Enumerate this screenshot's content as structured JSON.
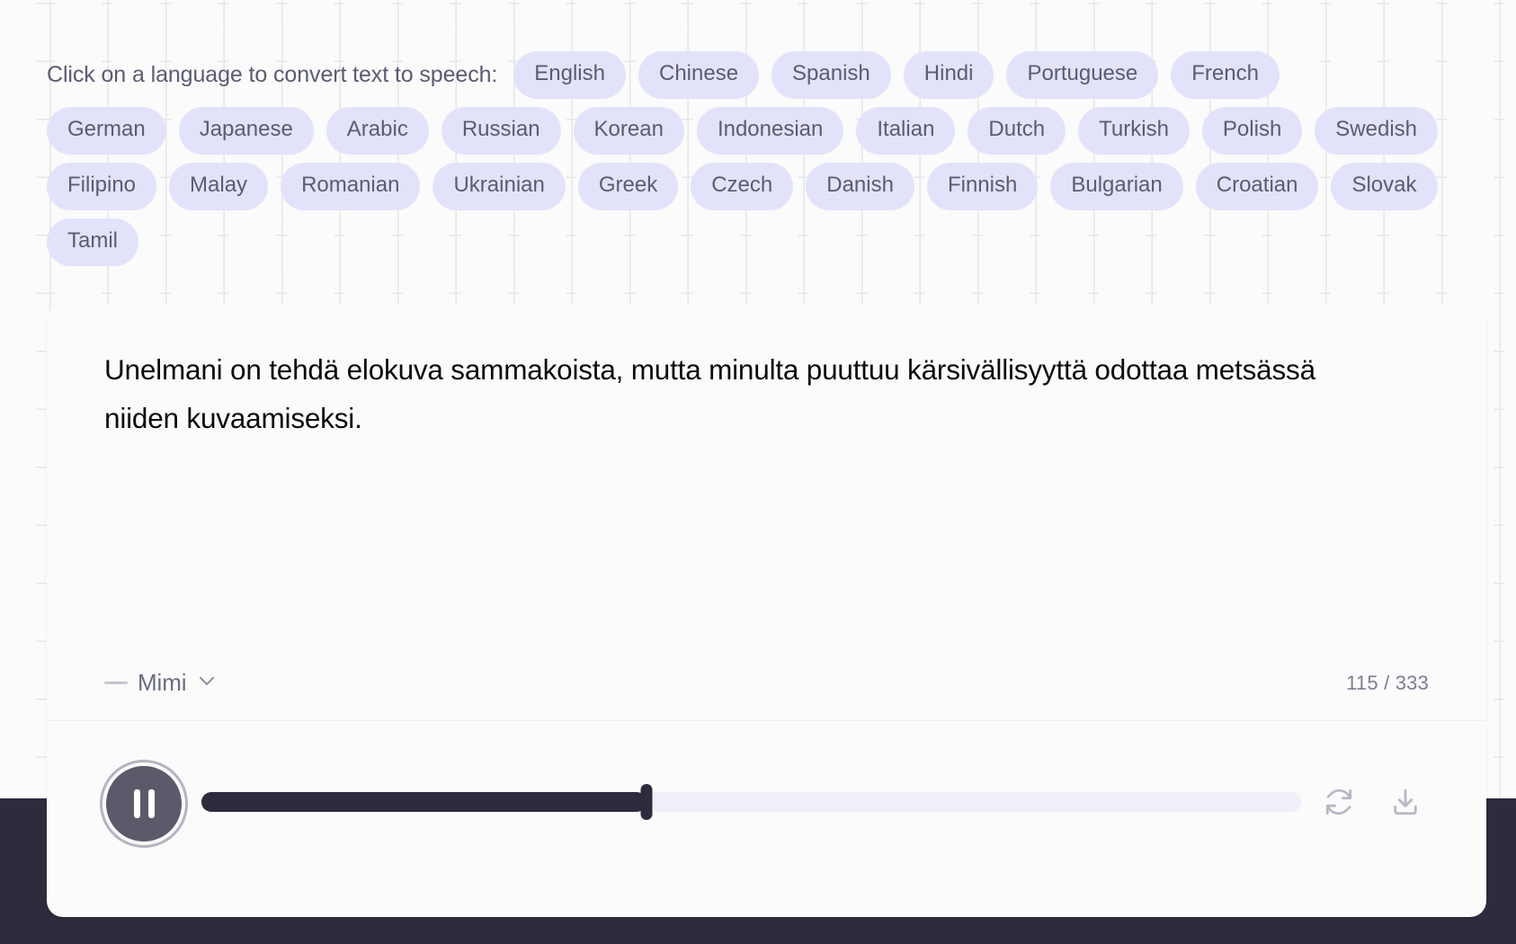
{
  "background": {
    "page_bg": "#fafbfa",
    "band_color": "#2e2b3d",
    "grid_color": "#e6e6e6"
  },
  "language_selector": {
    "prompt": "Click on a language to convert text to speech:",
    "chip_bg": "#e2e3fa",
    "chip_text_color": "#5b5c72",
    "rows": [
      [
        "English",
        "Chinese",
        "Spanish",
        "Hindi",
        "Portuguese",
        "French"
      ],
      [
        "German",
        "Japanese",
        "Arabic",
        "Russian",
        "Korean",
        "Indonesian",
        "Italian",
        "Dutch",
        "Turkish",
        "Polish",
        "Swedish"
      ],
      [
        "Filipino",
        "Malay",
        "Romanian",
        "Ukrainian",
        "Greek",
        "Czech",
        "Danish",
        "Finnish",
        "Bulgarian",
        "Croatian",
        "Slovak"
      ],
      [
        "Tamil"
      ]
    ]
  },
  "card": {
    "text": "Unelmani on tehdä elokuva sammakoista, mutta minulta puuttuu kärsivällisyyttä odottaa metsässä niiden kuvaamiseksi.",
    "voice": {
      "name": "Mimi",
      "chevron_icon": "chevron-down-icon"
    },
    "char_count": "115 / 333"
  },
  "player": {
    "state": "playing",
    "play_pause_icon": "pause-icon",
    "progress_percent": 40.5,
    "fill_color": "#2e2b3d",
    "track_color": "#eff0f7",
    "button_color": "#5b5a6b",
    "actions": [
      {
        "name": "regenerate-icon",
        "label": "Regenerate"
      },
      {
        "name": "download-icon",
        "label": "Download"
      }
    ]
  }
}
